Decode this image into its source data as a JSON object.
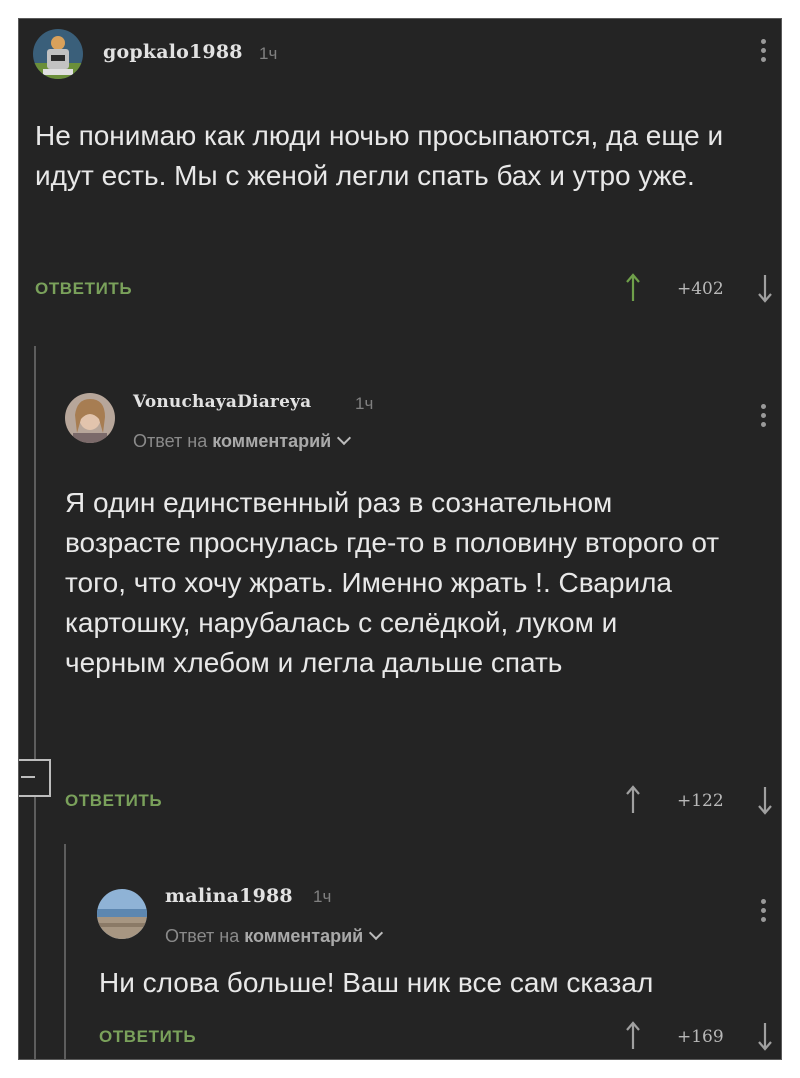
{
  "comments": [
    {
      "username": "gopkalo1988",
      "time": "1ч",
      "reply_prefix": "",
      "reply_target": "",
      "text": "Не понимаю как люди ночью просыпаются, да еще и идут есть. Мы с женой легли спать бах и утро уже.",
      "reply_label": "ОТВЕТИТЬ",
      "score": "+402"
    },
    {
      "username": "VonuchayaDiareya",
      "time": "1ч",
      "reply_prefix": "Ответ на",
      "reply_target": "комментарий",
      "text": "Я один единственный раз в сознательном возрасте проснулась где-то в половину второго от того, что хочу жрать. Именно жрать !. Сварила картошку, нарубалась с селёдкой, луком и черным хлебом и легла дальше спать",
      "reply_label": "ОТВЕТИТЬ",
      "score": "+122"
    },
    {
      "username": "malina1988",
      "time": "1ч",
      "reply_prefix": "Ответ на",
      "reply_target": "комментарий",
      "text": "Ни слова больше! Ваш ник все сам сказал",
      "reply_label": "ОТВЕТИТЬ",
      "score": "+169"
    }
  ],
  "icons": {
    "upvote": "arrow-up-icon",
    "downvote": "arrow-down-icon",
    "more": "kebab-menu-icon",
    "expand": "chevron-down-icon",
    "collapse": "collapse-thread-icon"
  },
  "colors": {
    "background": "#242424",
    "text": "#e8e8e8",
    "reply_button": "#7aa15b",
    "upvote_arrow": "#6fa04a",
    "downvote_arrow": "#a0a0a0"
  }
}
